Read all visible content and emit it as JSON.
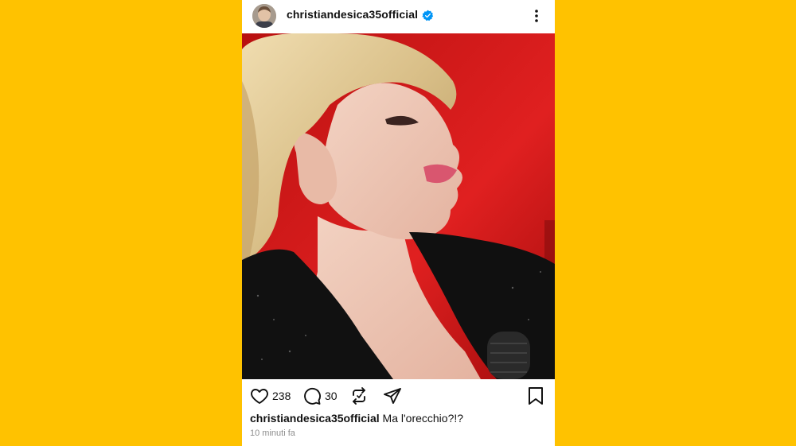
{
  "post": {
    "username": "christiandesica35official",
    "verified": true,
    "likes": "238",
    "comments": "30",
    "caption_user": "christiandesica35official",
    "caption_text": "Ma l'orecchio?!?",
    "timestamp": "10 minuti fa",
    "image_description_icon": "photo-of-woman-in-profile"
  },
  "icons": {
    "like": "heart-icon",
    "comment": "comment-bubble-icon",
    "repost": "repost-icon",
    "share": "paper-plane-icon",
    "save": "bookmark-icon",
    "more": "more-vertical-icon",
    "verified": "verified-badge-icon"
  },
  "colors": {
    "background": "#FFC200",
    "card": "#FFFFFF",
    "verified": "#0095F6",
    "photo_backdrop": "#D01717"
  }
}
